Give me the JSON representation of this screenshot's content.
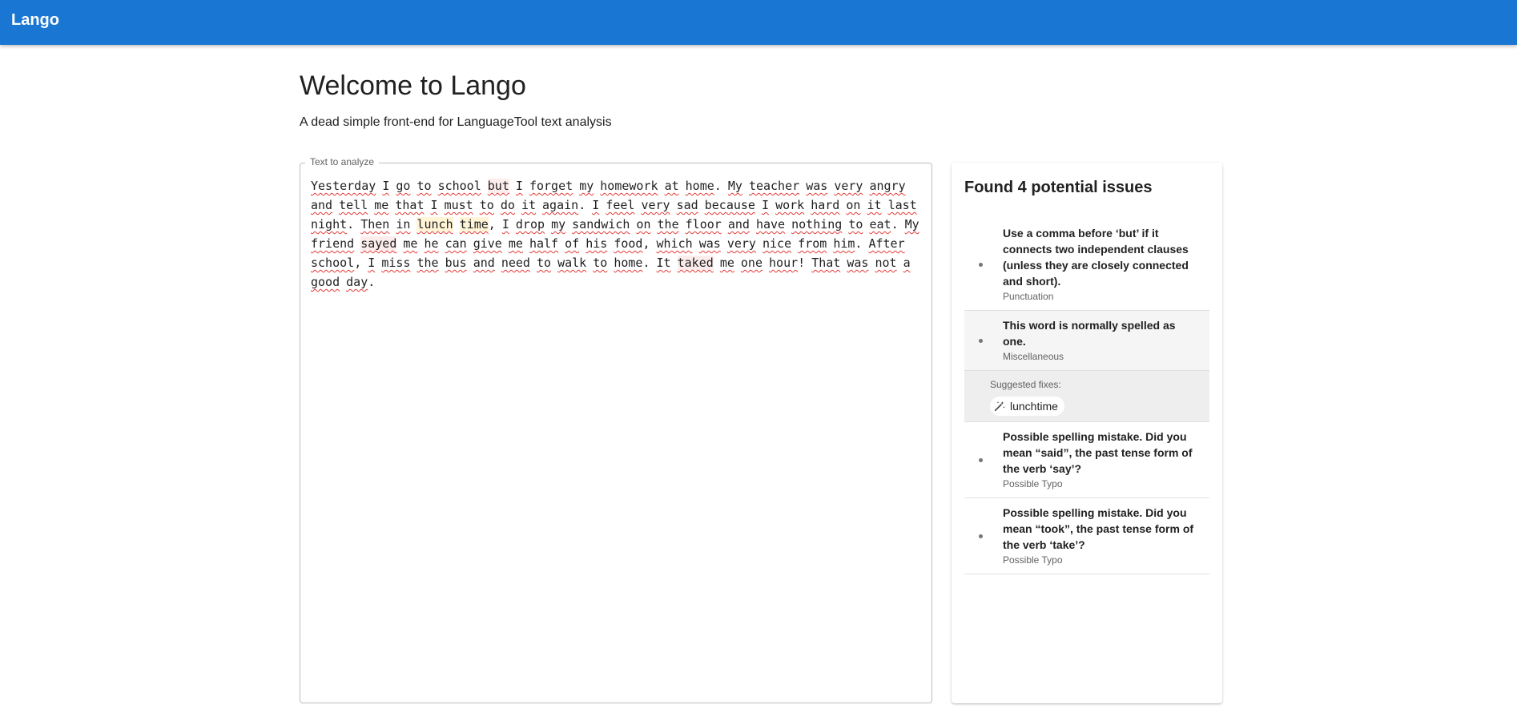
{
  "app": {
    "title": "Lango"
  },
  "page": {
    "title": "Welcome to Lango",
    "subtitle": "A dead simple front-end for LanguageTool text analysis"
  },
  "editor": {
    "label": "Text to analyze",
    "text": "Yesterday I go to school but I forget my homework at home. My teacher was very angry and tell me that I must to do it again. I feel very sad because I work hard on it last night. Then in lunch time, I drop my sandwich on the floor and have nothing to eat. My friend sayed me he can give me half of his food, which was very nice from him. After school, I miss the bus and need to walk to home. It taked me one hour! That was not a good day."
  },
  "issues": {
    "title": "Found 4 potential issues",
    "items": [
      {
        "message": "Use a comma before ‘but’ if it connects two independent clauses (unless they are closely connected and short).",
        "category": "Punctuation"
      },
      {
        "message": "This word is normally spelled as one.",
        "category": "Miscellaneous",
        "selected": true,
        "fixes_label": "Suggested fixes:",
        "fixes": [
          "lunchtime"
        ]
      },
      {
        "message": "Possible spelling mistake. Did you mean “said”, the past tense form of the verb ‘say’?",
        "category": "Possible Typo"
      },
      {
        "message": "Possible spelling mistake. Did you mean “took”, the past tense form of the verb ‘take’?",
        "category": "Possible Typo"
      }
    ]
  },
  "icons": {
    "fix_chip": "magic-wand-icon"
  },
  "colors": {
    "appbar": "#1976d2",
    "spell_underline": "#e53935",
    "highlight_error": "#fdecec",
    "highlight_style": "#fff4d6"
  }
}
